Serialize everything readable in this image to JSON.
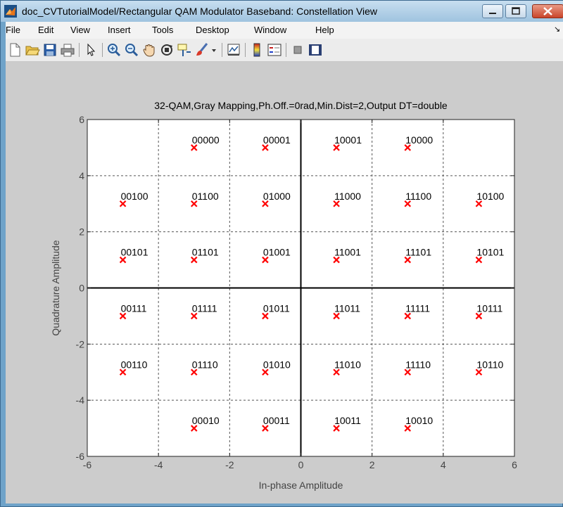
{
  "window": {
    "title": "doc_CVTutorialModel/Rectangular QAM Modulator Baseband: Constellation View"
  },
  "menu": [
    "File",
    "Edit",
    "View",
    "Insert",
    "Tools",
    "Desktop",
    "Window",
    "Help"
  ],
  "toolbar_icons": [
    "new-file-icon",
    "open-folder-icon",
    "save-icon",
    "print-icon",
    "pointer-icon",
    "zoom-in-icon",
    "zoom-out-icon",
    "pan-hand-icon",
    "rotate-3d-icon",
    "data-cursor-icon",
    "brush-icon",
    "link-plot-icon",
    "colorbar-icon",
    "legend-icon",
    "hide-plot-tools-icon",
    "show-plot-tools-icon"
  ],
  "chart_data": {
    "type": "scatter",
    "title": "32-QAM,Gray Mapping,Ph.Off.=0rad,Min.Dist=2,Output DT=double",
    "xlabel": "In-phase Amplitude",
    "ylabel": "Quadrature Amplitude",
    "xlim": [
      -6,
      6
    ],
    "ylim": [
      -6,
      6
    ],
    "xticks": [
      -6,
      -4,
      -2,
      0,
      2,
      4,
      6
    ],
    "yticks": [
      -6,
      -4,
      -2,
      0,
      2,
      4,
      6
    ],
    "xtick_labels": [
      "-6",
      "-4",
      "-2",
      "0",
      "2",
      "4",
      "6"
    ],
    "ytick_labels": [
      "-6",
      "-4",
      "-2",
      "0",
      "2",
      "4",
      "6"
    ],
    "grid": true,
    "marker_color": "#ff0000",
    "points": [
      {
        "x": -3,
        "y": 5,
        "label": "00000"
      },
      {
        "x": -1,
        "y": 5,
        "label": "00001"
      },
      {
        "x": 1,
        "y": 5,
        "label": "10001"
      },
      {
        "x": 3,
        "y": 5,
        "label": "10000"
      },
      {
        "x": -5,
        "y": 3,
        "label": "00100"
      },
      {
        "x": -3,
        "y": 3,
        "label": "01100"
      },
      {
        "x": -1,
        "y": 3,
        "label": "01000"
      },
      {
        "x": 1,
        "y": 3,
        "label": "11000"
      },
      {
        "x": 3,
        "y": 3,
        "label": "11100"
      },
      {
        "x": 5,
        "y": 3,
        "label": "10100"
      },
      {
        "x": -5,
        "y": 1,
        "label": "00101"
      },
      {
        "x": -3,
        "y": 1,
        "label": "01101"
      },
      {
        "x": -1,
        "y": 1,
        "label": "01001"
      },
      {
        "x": 1,
        "y": 1,
        "label": "11001"
      },
      {
        "x": 3,
        "y": 1,
        "label": "11101"
      },
      {
        "x": 5,
        "y": 1,
        "label": "10101"
      },
      {
        "x": -5,
        "y": -1,
        "label": "00111"
      },
      {
        "x": -3,
        "y": -1,
        "label": "01111"
      },
      {
        "x": -1,
        "y": -1,
        "label": "01011"
      },
      {
        "x": 1,
        "y": -1,
        "label": "11011"
      },
      {
        "x": 3,
        "y": -1,
        "label": "11111"
      },
      {
        "x": 5,
        "y": -1,
        "label": "10111"
      },
      {
        "x": -5,
        "y": -3,
        "label": "00110"
      },
      {
        "x": -3,
        "y": -3,
        "label": "01110"
      },
      {
        "x": -1,
        "y": -3,
        "label": "01010"
      },
      {
        "x": 1,
        "y": -3,
        "label": "11010"
      },
      {
        "x": 3,
        "y": -3,
        "label": "11110"
      },
      {
        "x": 5,
        "y": -3,
        "label": "10110"
      },
      {
        "x": -3,
        "y": -5,
        "label": "00010"
      },
      {
        "x": -1,
        "y": -5,
        "label": "00011"
      },
      {
        "x": 1,
        "y": -5,
        "label": "10011"
      },
      {
        "x": 3,
        "y": -5,
        "label": "10010"
      }
    ]
  }
}
